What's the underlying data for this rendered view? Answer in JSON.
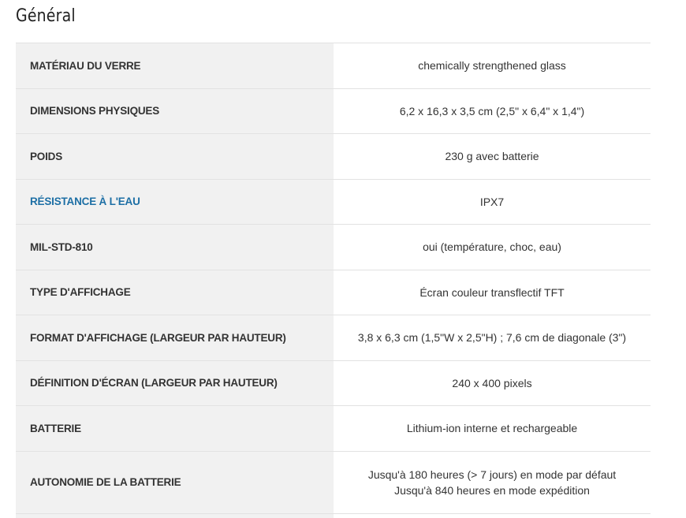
{
  "section": {
    "title": "Général"
  },
  "specs": [
    {
      "label": "MATÉRIAU DU VERRE",
      "value": "chemically strengthened glass",
      "link": false
    },
    {
      "label": "DIMENSIONS PHYSIQUES",
      "value": "6,2 x 16,3 x 3,5 cm (2,5\" x 6,4\" x 1,4\")",
      "link": false
    },
    {
      "label": "POIDS",
      "value": "230 g avec batterie",
      "link": false
    },
    {
      "label": "RÉSISTANCE À L'EAU",
      "value": "IPX7",
      "link": true
    },
    {
      "label": "MIL-STD-810",
      "value": "oui (température, choc, eau)",
      "link": false
    },
    {
      "label": "TYPE D'AFFICHAGE",
      "value": "Écran couleur transflectif TFT",
      "link": false
    },
    {
      "label": "FORMAT D'AFFICHAGE (LARGEUR PAR HAUTEUR)",
      "value": "3,8 x 6,3 cm (1,5\"W x 2,5\"H) ; 7,6 cm de diagonale (3\")",
      "link": false
    },
    {
      "label": "DÉFINITION D'ÉCRAN (LARGEUR PAR HAUTEUR)",
      "value": "240 x 400 pixels",
      "link": false
    },
    {
      "label": "BATTERIE",
      "value": "Lithium-ion interne et rechargeable",
      "link": false
    },
    {
      "label": "AUTONOMIE DE LA BATTERIE",
      "value_lines": [
        "Jusqu'à 180 heures (> 7 jours) en mode par défaut",
        "Jusqu'à 840 heures en mode expédition"
      ],
      "link": false
    }
  ],
  "colors": {
    "label_bg": "#f1f1f1",
    "value_bg": "#ffffff",
    "link_text": "#1d6fa5",
    "text": "#333333",
    "border": "#e2e2e2"
  }
}
